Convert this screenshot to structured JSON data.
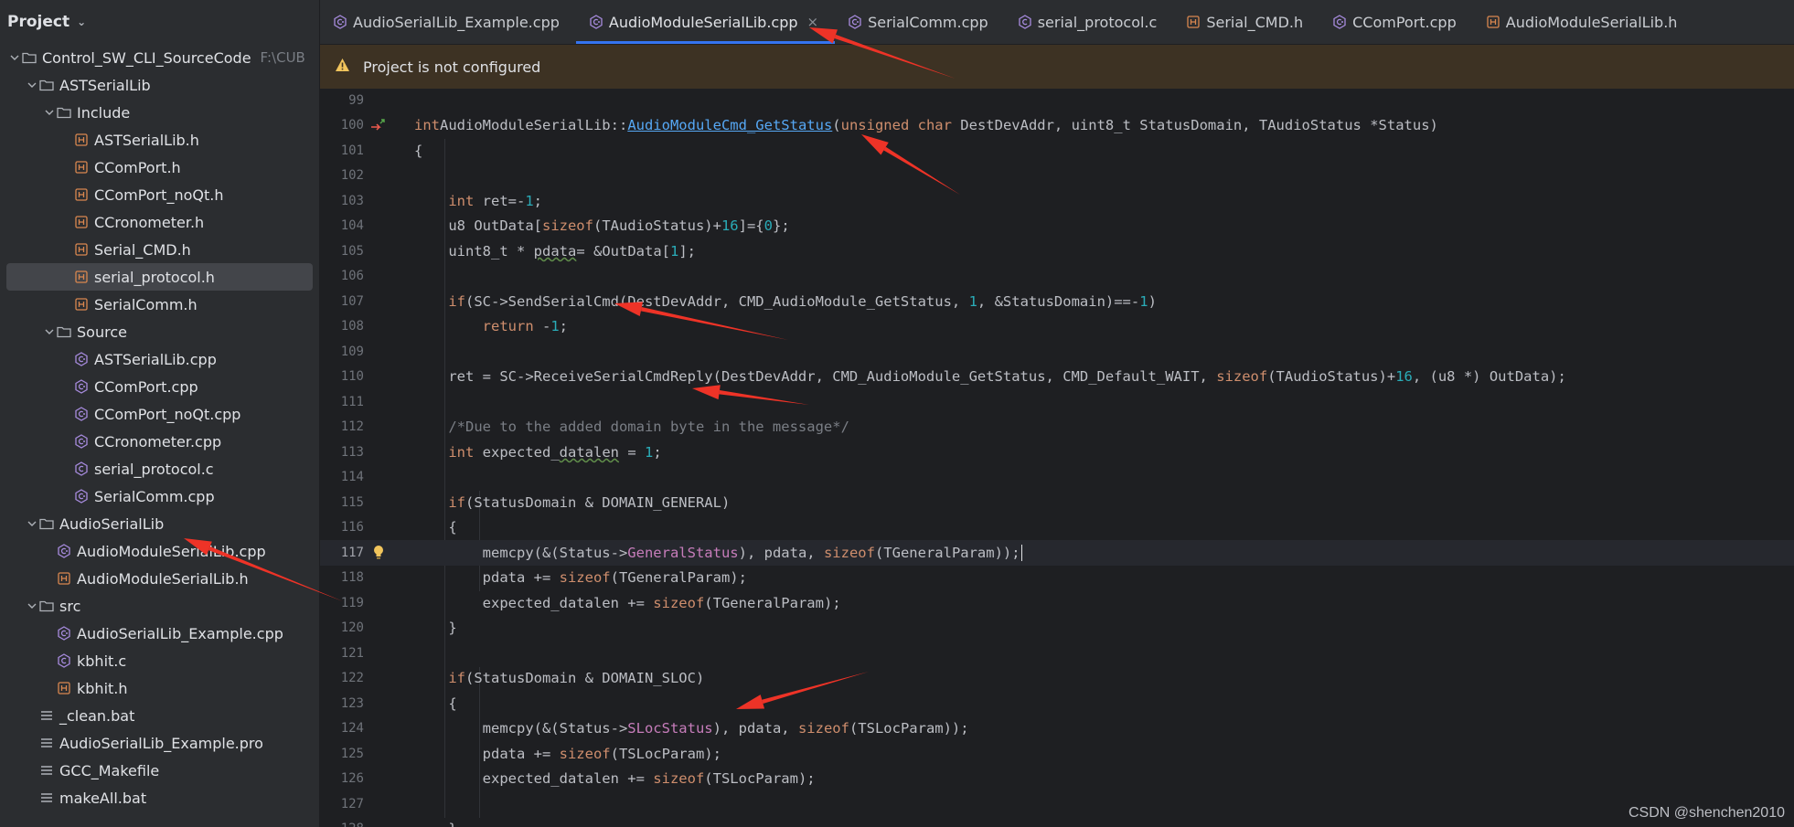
{
  "colors": {
    "accent": "#3574f0",
    "arrow": "#ee3327",
    "banner_bg": "#3d3223"
  },
  "sidebar": {
    "title": "Project",
    "tree": [
      {
        "label": "Control_SW_CLI_SourceCode",
        "depth": 0,
        "type": "folder",
        "open": true,
        "hint": "F:\\CUB"
      },
      {
        "label": "ASTSerialLib",
        "depth": 1,
        "type": "folder",
        "open": true
      },
      {
        "label": "Include",
        "depth": 2,
        "type": "folder",
        "open": true
      },
      {
        "label": "ASTSerialLib.h",
        "depth": 3,
        "type": "h"
      },
      {
        "label": "CComPort.h",
        "depth": 3,
        "type": "h"
      },
      {
        "label": "CComPort_noQt.h",
        "depth": 3,
        "type": "h"
      },
      {
        "label": "CCronometer.h",
        "depth": 3,
        "type": "h"
      },
      {
        "label": "Serial_CMD.h",
        "depth": 3,
        "type": "h"
      },
      {
        "label": "serial_protocol.h",
        "depth": 3,
        "type": "h",
        "selected": true
      },
      {
        "label": "SerialComm.h",
        "depth": 3,
        "type": "h"
      },
      {
        "label": "Source",
        "depth": 2,
        "type": "folder",
        "open": true
      },
      {
        "label": "ASTSerialLib.cpp",
        "depth": 3,
        "type": "cpp"
      },
      {
        "label": "CComPort.cpp",
        "depth": 3,
        "type": "cpp"
      },
      {
        "label": "CComPort_noQt.cpp",
        "depth": 3,
        "type": "cpp"
      },
      {
        "label": "CCronometer.cpp",
        "depth": 3,
        "type": "cpp"
      },
      {
        "label": "serial_protocol.c",
        "depth": 3,
        "type": "c"
      },
      {
        "label": "SerialComm.cpp",
        "depth": 3,
        "type": "cpp"
      },
      {
        "label": "AudioSerialLib",
        "depth": 1,
        "type": "folder",
        "open": true
      },
      {
        "label": "AudioModuleSerialLib.cpp",
        "depth": 2,
        "type": "cpp"
      },
      {
        "label": "AudioModuleSerialLib.h",
        "depth": 2,
        "type": "h"
      },
      {
        "label": "src",
        "depth": 1,
        "type": "folder",
        "open": true
      },
      {
        "label": "AudioSerialLib_Example.cpp",
        "depth": 2,
        "type": "cpp"
      },
      {
        "label": "kbhit.c",
        "depth": 2,
        "type": "c"
      },
      {
        "label": "kbhit.h",
        "depth": 2,
        "type": "h"
      },
      {
        "label": "_clean.bat",
        "depth": 1,
        "type": "text"
      },
      {
        "label": "AudioSerialLib_Example.pro",
        "depth": 1,
        "type": "text"
      },
      {
        "label": "GCC_Makefile",
        "depth": 1,
        "type": "text"
      },
      {
        "label": "makeAll.bat",
        "depth": 1,
        "type": "text"
      }
    ]
  },
  "tabs": [
    {
      "label": "AudioSerialLib_Example.cpp",
      "type": "cpp"
    },
    {
      "label": "AudioModuleSerialLib.cpp",
      "type": "cpp",
      "active": true
    },
    {
      "label": "SerialComm.cpp",
      "type": "cpp"
    },
    {
      "label": "serial_protocol.c",
      "type": "c"
    },
    {
      "label": "Serial_CMD.h",
      "type": "h"
    },
    {
      "label": "CComPort.cpp",
      "type": "cpp"
    },
    {
      "label": "AudioModuleSerialLib.h",
      "type": "h"
    }
  ],
  "banner": {
    "text": "Project is not configured"
  },
  "editor": {
    "current_line": 117,
    "lines": [
      {
        "n": 99,
        "t": []
      },
      {
        "n": 100,
        "t": [
          [
            "kw",
            "int"
          ],
          [
            "",
            "AudioModuleSerialLib::"
          ],
          [
            "fnu",
            "AudioModuleCmd_GetStatus"
          ],
          [
            "",
            "("
          ],
          [
            "kw",
            "unsigned char"
          ],
          [
            "",
            " DestDevAddr, uint8_t StatusDomain, TAudioStatus *Status)"
          ]
        ]
      },
      {
        "n": 101,
        "t": [
          [
            "",
            "{"
          ]
        ]
      },
      {
        "n": 102,
        "t": []
      },
      {
        "n": 103,
        "t": [
          [
            "",
            "    "
          ],
          [
            "kw",
            "int"
          ],
          [
            "",
            " ret=-"
          ],
          [
            "num",
            "1"
          ],
          [
            "",
            ";"
          ]
        ]
      },
      {
        "n": 104,
        "t": [
          [
            "",
            "    u8 OutData["
          ],
          [
            "kw",
            "sizeof"
          ],
          [
            "",
            "(TAudioStatus)+"
          ],
          [
            "num",
            "16"
          ],
          [
            "",
            "]={"
          ],
          [
            "num",
            "0"
          ],
          [
            "",
            "};"
          ]
        ]
      },
      {
        "n": 105,
        "t": [
          [
            "",
            "    uint8_t * "
          ],
          [
            "squig",
            "pdata"
          ],
          [
            "",
            "= &OutData["
          ],
          [
            "num",
            "1"
          ],
          [
            "",
            "];"
          ]
        ]
      },
      {
        "n": 106,
        "t": []
      },
      {
        "n": 107,
        "t": [
          [
            "",
            "    "
          ],
          [
            "kw",
            "if"
          ],
          [
            "",
            "(SC->SendSerialCmd(DestDevAddr, CMD_AudioModule_GetStatus, "
          ],
          [
            "num",
            "1"
          ],
          [
            "",
            ", &StatusDomain)==-"
          ],
          [
            "num",
            "1"
          ],
          [
            "",
            ")"
          ]
        ]
      },
      {
        "n": 108,
        "t": [
          [
            "",
            "        "
          ],
          [
            "kw",
            "return"
          ],
          [
            "",
            " -"
          ],
          [
            "num",
            "1"
          ],
          [
            "",
            ";"
          ]
        ]
      },
      {
        "n": 109,
        "t": []
      },
      {
        "n": 110,
        "t": [
          [
            "",
            "    ret = SC->ReceiveSerialCmdReply(DestDevAddr, CMD_AudioModule_GetStatus, CMD_Default_WAIT, "
          ],
          [
            "kw",
            "sizeof"
          ],
          [
            "",
            "(TAudioStatus)+"
          ],
          [
            "num",
            "16"
          ],
          [
            "",
            ", (u8 *) OutData);"
          ]
        ]
      },
      {
        "n": 111,
        "t": []
      },
      {
        "n": 112,
        "t": [
          [
            "",
            "    "
          ],
          [
            "cmt",
            "/*Due to the added domain byte in the message*/"
          ]
        ]
      },
      {
        "n": 113,
        "t": [
          [
            "",
            "    "
          ],
          [
            "kw",
            "int"
          ],
          [
            "",
            " expected_"
          ],
          [
            "squig",
            "datalen"
          ],
          [
            "",
            " = "
          ],
          [
            "num",
            "1"
          ],
          [
            "",
            ";"
          ]
        ]
      },
      {
        "n": 114,
        "t": []
      },
      {
        "n": 115,
        "t": [
          [
            "",
            "    "
          ],
          [
            "kw",
            "if"
          ],
          [
            "",
            "(StatusDomain & DOMAIN_GENERAL)"
          ]
        ]
      },
      {
        "n": 116,
        "t": [
          [
            "",
            "    {"
          ]
        ]
      },
      {
        "n": 117,
        "t": [
          [
            "",
            "        memcpy(&(Status->"
          ],
          [
            "fld",
            "GeneralStatus"
          ],
          [
            "",
            "), pdata, "
          ],
          [
            "kw",
            "sizeof"
          ],
          [
            "",
            "(TGeneralParam));"
          ]
        ]
      },
      {
        "n": 118,
        "t": [
          [
            "",
            "        pdata += "
          ],
          [
            "kw",
            "sizeof"
          ],
          [
            "",
            "(TGeneralParam);"
          ]
        ]
      },
      {
        "n": 119,
        "t": [
          [
            "",
            "        expected_datalen += "
          ],
          [
            "kw",
            "sizeof"
          ],
          [
            "",
            "(TGeneralParam);"
          ]
        ]
      },
      {
        "n": 120,
        "t": [
          [
            "",
            "    }"
          ]
        ]
      },
      {
        "n": 121,
        "t": []
      },
      {
        "n": 122,
        "t": [
          [
            "",
            "    "
          ],
          [
            "kw",
            "if"
          ],
          [
            "",
            "(StatusDomain & DOMAIN_SLOC)"
          ]
        ]
      },
      {
        "n": 123,
        "t": [
          [
            "",
            "    {"
          ]
        ]
      },
      {
        "n": 124,
        "t": [
          [
            "",
            "        memcpy(&(Status->"
          ],
          [
            "fld",
            "SLocStatus"
          ],
          [
            "",
            "), pdata, "
          ],
          [
            "kw",
            "sizeof"
          ],
          [
            "",
            "(TSLocParam));"
          ]
        ]
      },
      {
        "n": 125,
        "t": [
          [
            "",
            "        pdata += "
          ],
          [
            "kw",
            "sizeof"
          ],
          [
            "",
            "(TSLocParam);"
          ]
        ]
      },
      {
        "n": 126,
        "t": [
          [
            "",
            "        expected_datalen += "
          ],
          [
            "kw",
            "sizeof"
          ],
          [
            "",
            "(TSLocParam);"
          ]
        ]
      },
      {
        "n": 127,
        "t": []
      },
      {
        "n": 128,
        "t": [
          [
            "",
            "    }"
          ]
        ]
      }
    ]
  },
  "watermark": "CSDN @shenchen2010"
}
